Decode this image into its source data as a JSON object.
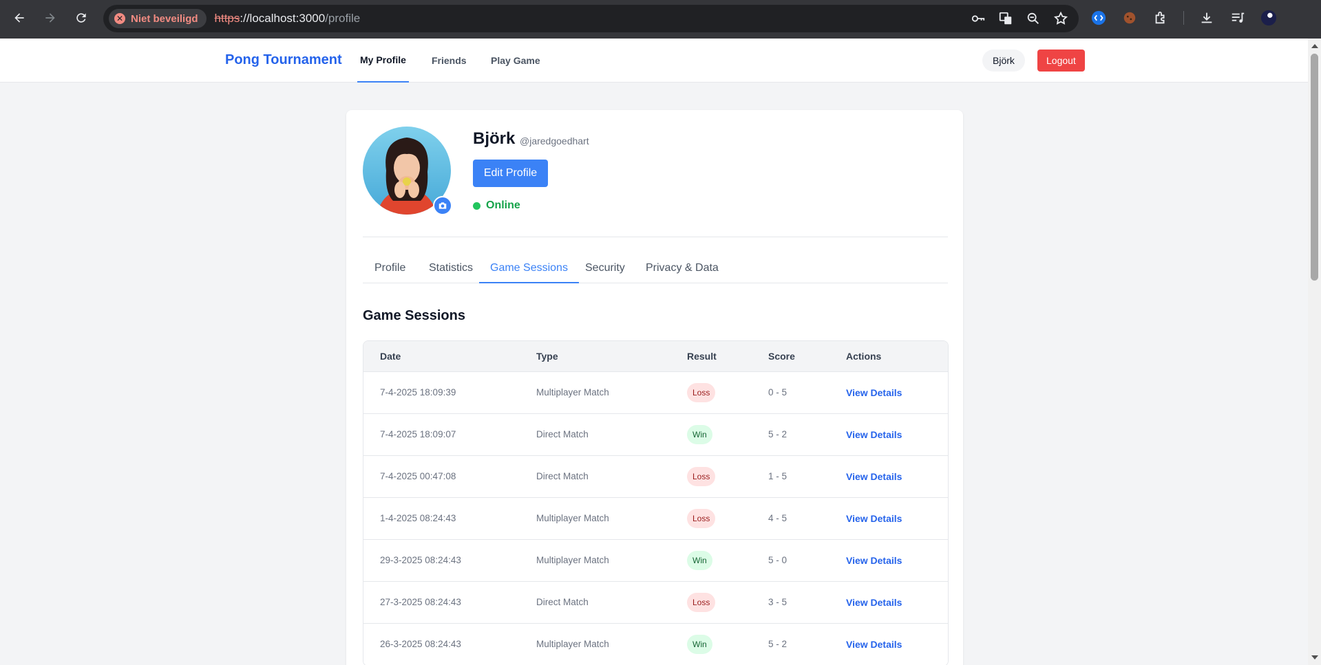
{
  "browser": {
    "security_label": "Niet beveiligd",
    "url_scheme": "https",
    "url_host": "://localhost:3000",
    "url_path": "/profile"
  },
  "header": {
    "brand": "Pong Tournament",
    "nav": [
      "My Profile",
      "Friends",
      "Play Game"
    ],
    "user_name": "Björk",
    "logout_label": "Logout"
  },
  "profile": {
    "display_name": "Björk",
    "handle": "@jaredgoedhart",
    "edit_label": "Edit Profile",
    "status": "Online"
  },
  "tabs": [
    "Profile",
    "Statistics",
    "Game Sessions",
    "Security",
    "Privacy & Data"
  ],
  "active_tab": "Game Sessions",
  "sessions": {
    "title": "Game Sessions",
    "columns": [
      "Date",
      "Type",
      "Result",
      "Score",
      "Actions"
    ],
    "rows": [
      {
        "date": "7-4-2025 18:09:39",
        "type": "Multiplayer Match",
        "result": "Loss",
        "score": "0 - 5",
        "action": "View Details"
      },
      {
        "date": "7-4-2025 18:09:07",
        "type": "Direct Match",
        "result": "Win",
        "score": "5 - 2",
        "action": "View Details"
      },
      {
        "date": "7-4-2025 00:47:08",
        "type": "Direct Match",
        "result": "Loss",
        "score": "1 - 5",
        "action": "View Details"
      },
      {
        "date": "1-4-2025 08:24:43",
        "type": "Multiplayer Match",
        "result": "Loss",
        "score": "4 - 5",
        "action": "View Details"
      },
      {
        "date": "29-3-2025 08:24:43",
        "type": "Multiplayer Match",
        "result": "Win",
        "score": "5 - 0",
        "action": "View Details"
      },
      {
        "date": "27-3-2025 08:24:43",
        "type": "Direct Match",
        "result": "Loss",
        "score": "3 - 5",
        "action": "View Details"
      },
      {
        "date": "26-3-2025 08:24:43",
        "type": "Multiplayer Match",
        "result": "Win",
        "score": "5 - 2",
        "action": "View Details"
      }
    ]
  },
  "colors": {
    "brand": "#2563eb",
    "primary": "#3b82f6",
    "danger": "#ef4444",
    "online": "#22c55e"
  }
}
